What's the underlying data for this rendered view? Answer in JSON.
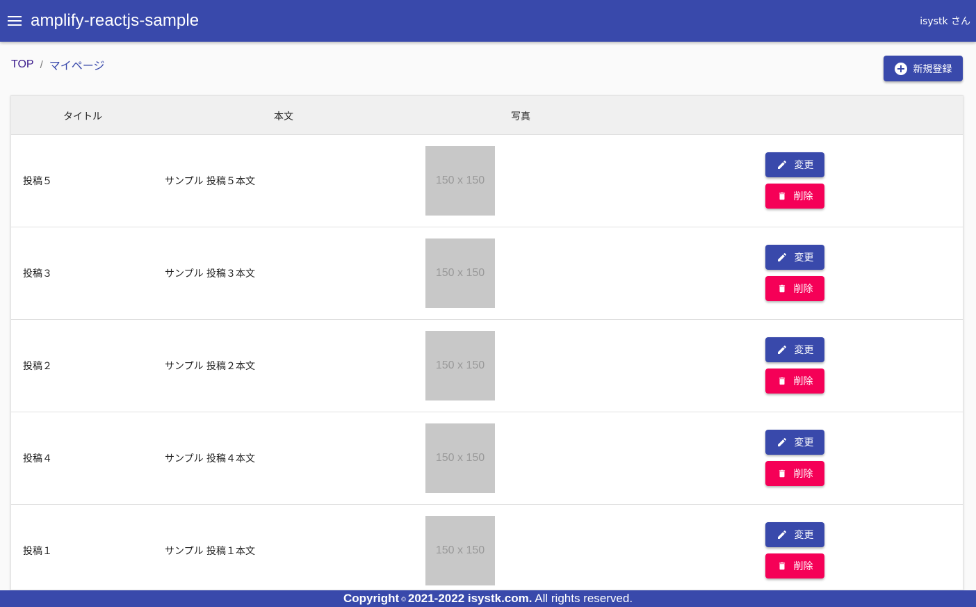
{
  "header": {
    "menu_icon": "menu-icon",
    "app_title": "amplify-reactjs-sample",
    "user_label": "isystk さん"
  },
  "breadcrumb": {
    "top": "TOP",
    "separator": "/",
    "current": "マイページ"
  },
  "actions": {
    "new_label": "新規登録",
    "new_icon": "add-circle-icon"
  },
  "table": {
    "columns": [
      "タイトル",
      "本文",
      "写真"
    ],
    "edit_label": "変更",
    "delete_label": "削除",
    "rows": [
      {
        "title": "投稿５",
        "body": "サンプル 投稿５本文",
        "photo": "150 x 150"
      },
      {
        "title": "投稿３",
        "body": "サンプル 投稿３本文",
        "photo": "150 x 150"
      },
      {
        "title": "投稿２",
        "body": "サンプル 投稿２本文",
        "photo": "150 x 150"
      },
      {
        "title": "投稿４",
        "body": "サンプル 投稿４本文",
        "photo": "150 x 150"
      },
      {
        "title": "投稿１",
        "body": "サンプル 投稿１本文",
        "photo": "150 x 150"
      }
    ]
  },
  "footer": {
    "copyright_word": "Copyright",
    "symbol": "©",
    "years_company": "2021-2022 isystk.com.",
    "rights": "All rights reserved."
  },
  "colors": {
    "primary": "#3949ab",
    "secondary": "#f50057",
    "thumb": "#c8c8c8"
  }
}
